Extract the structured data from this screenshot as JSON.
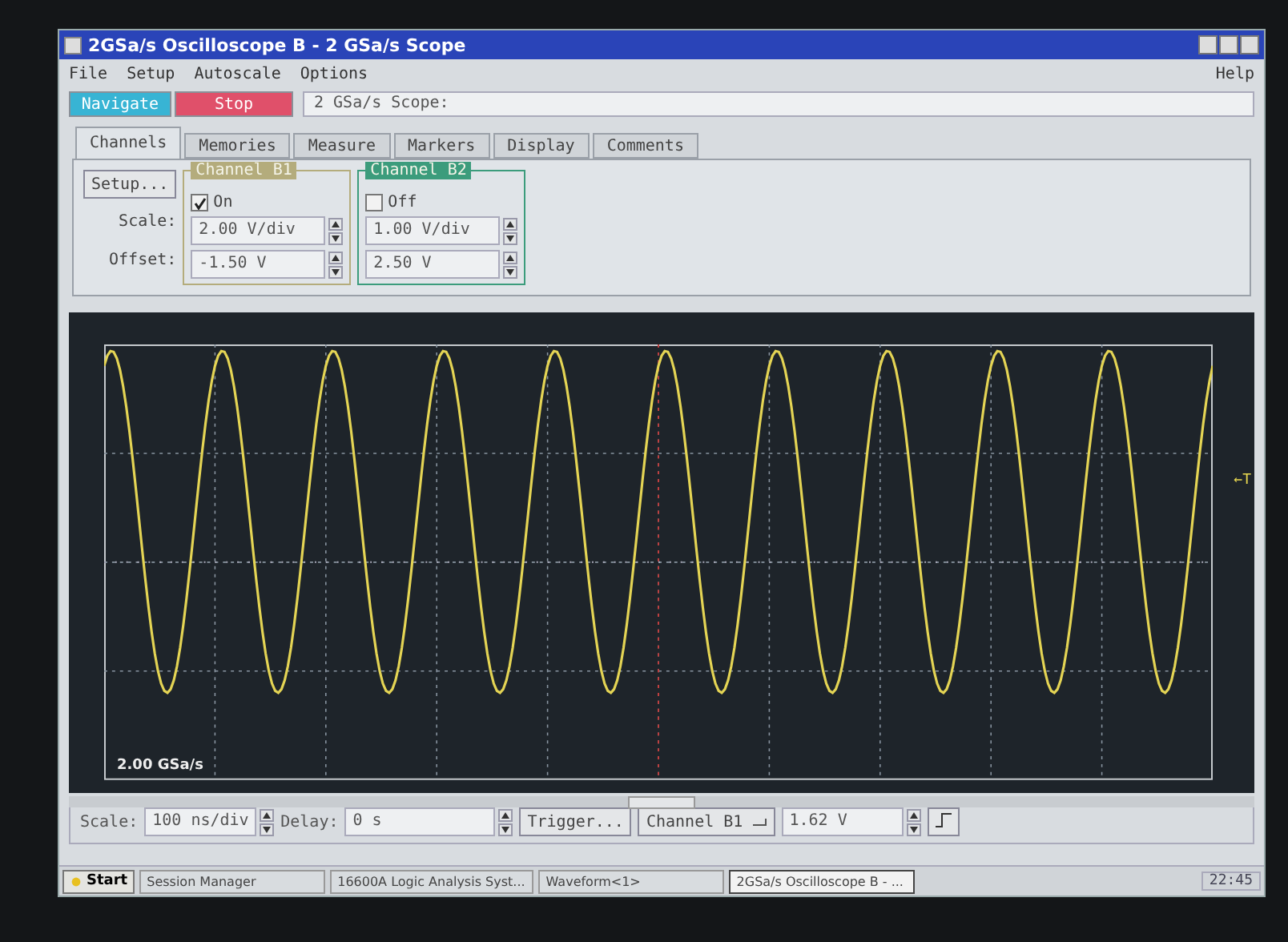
{
  "window": {
    "title": "2GSa/s Oscilloscope B - 2 GSa/s Scope"
  },
  "menu": [
    "File",
    "Setup",
    "Autoscale",
    "Options"
  ],
  "help": "Help",
  "toolbar": {
    "navigate": "Navigate",
    "stop": "Stop",
    "status": "2 GSa/s Scope:"
  },
  "tabs": [
    {
      "label": "Channels",
      "selected": true
    },
    {
      "label": "Memories",
      "selected": false
    },
    {
      "label": "Measure",
      "selected": false
    },
    {
      "label": "Markers",
      "selected": false
    },
    {
      "label": "Display",
      "selected": false
    },
    {
      "label": "Comments",
      "selected": false
    }
  ],
  "channels_panel": {
    "setup": "Setup...",
    "scale_label": "Scale:",
    "offset_label": "Offset:",
    "channels": [
      {
        "title": "Channel B1",
        "color": "#b4ac7c",
        "state_label": "On",
        "checked": true,
        "scale": "2.00 V/div",
        "offset": "-1.50 V"
      },
      {
        "title": "Channel B2",
        "color": "#3c9c7c",
        "state_label": "Off",
        "checked": false,
        "scale": "1.00 V/div",
        "offset": "2.50 V"
      }
    ]
  },
  "display": {
    "sample_rate": "2.00 GSa/s",
    "trigger_marker": "←T"
  },
  "controls": {
    "scale_label": "Scale:",
    "scale": "100 ns/div",
    "delay_label": "Delay:",
    "delay": "0 s",
    "trigger": "Trigger...",
    "source": "Channel B1",
    "level": "1.62 V"
  },
  "taskbar": {
    "start": "Start",
    "tasks": [
      {
        "label": "Session Manager",
        "selected": false
      },
      {
        "label": "16600A Logic Analysis Syst...",
        "selected": false
      },
      {
        "label": "Waveform<1>",
        "selected": false
      },
      {
        "label": "2GSa/s Oscilloscope B - ...",
        "selected": true
      }
    ],
    "clock": "22:45"
  }
}
